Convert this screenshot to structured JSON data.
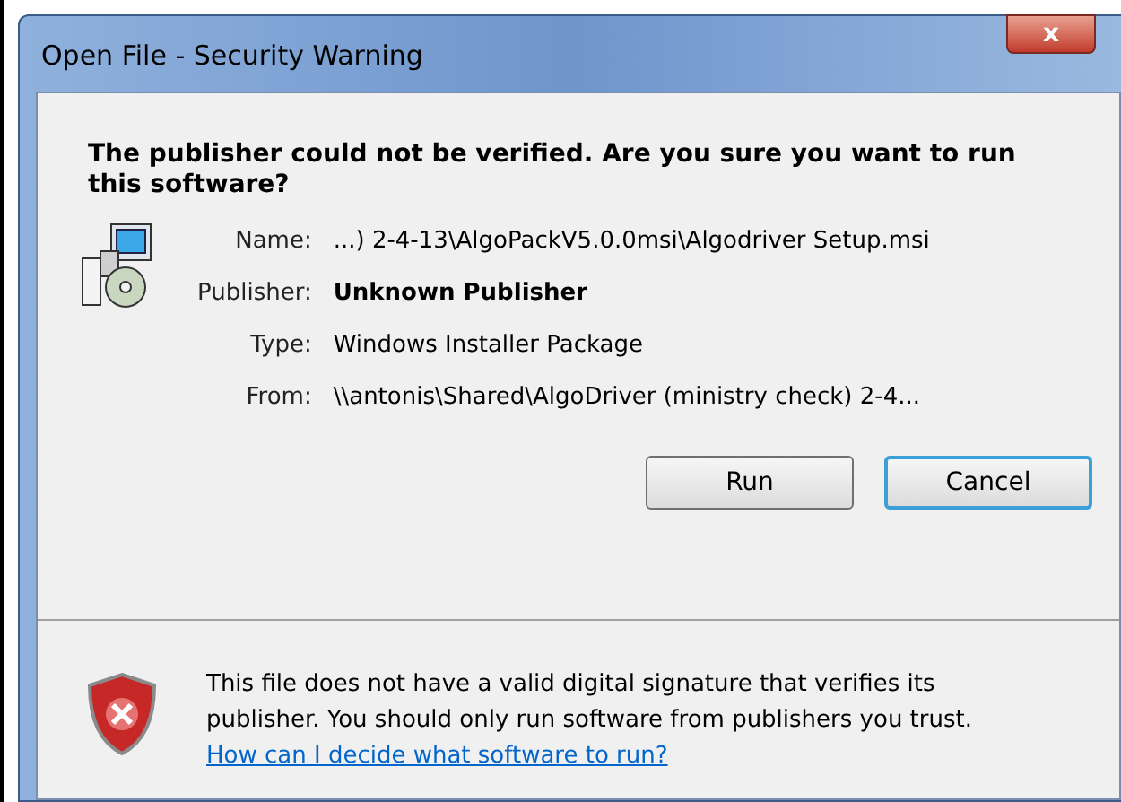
{
  "window": {
    "title": "Open File - Security Warning",
    "close_glyph": "x"
  },
  "question": "The publisher could not be verified.  Are you sure you want to run this software?",
  "details": [
    {
      "label": "Name:",
      "value": "...) 2-4-13\\AlgoPackV5.0.0msi\\Algodriver Setup.msi",
      "bold": false
    },
    {
      "label": "Publisher:",
      "value": "Unknown Publisher",
      "bold": true
    },
    {
      "label": "Type:",
      "value": "Windows Installer Package",
      "bold": false
    },
    {
      "label": "From:",
      "value": "\\\\antonis\\Shared\\AlgoDriver (ministry check) 2-4...",
      "bold": false
    }
  ],
  "buttons": [
    {
      "label": "Run",
      "focused": false
    },
    {
      "label": "Cancel",
      "focused": true
    }
  ],
  "warning": {
    "text": "This file does not have a valid digital signature that verifies its publisher.  You should only run software from publishers you trust.",
    "link": "How can I decide what software to run?"
  }
}
